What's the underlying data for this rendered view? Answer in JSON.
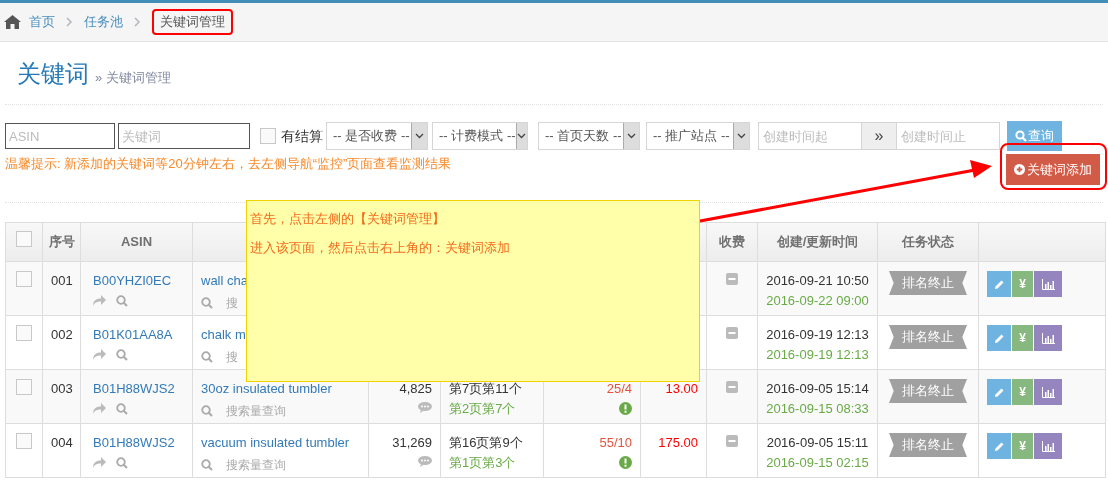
{
  "breadcrumb": [
    {
      "label": "首页",
      "current": false
    },
    {
      "label": "任务池",
      "current": false
    },
    {
      "label": "关键词管理",
      "current": true
    }
  ],
  "page_title": "关键词",
  "page_subtitle": "» 关键词管理",
  "filters": {
    "asin_placeholder": "ASIN",
    "keyword_placeholder": "关键词",
    "settled_label": "有结算",
    "settled_checked": false,
    "selects": [
      "-- 是否收费 --",
      "-- 计费模式 --",
      "-- 首页天数 --",
      "-- 推广站点 --"
    ],
    "date_from_placeholder": "创建时间起",
    "date_sep": "»",
    "date_to_placeholder": "创建时间止",
    "search_button": "查询"
  },
  "hint": "温馨提示: 新添加的关键词等20分钟左右，去左侧导航“监控”页面查看监测结果",
  "add_button": "关键词添加",
  "table": {
    "select_all_checked": false,
    "columns": [
      "序号",
      "ASIN",
      "收费",
      "创建/更新时间",
      "任务状态"
    ],
    "rows": [
      {
        "checked": false,
        "no": "001",
        "asin": "B00YHZI0EC",
        "keyword": "wall cha",
        "search_link": "搜",
        "created": "2016-09-21 10:50",
        "updated": "2016-09-22 09:00",
        "status": "排名终止",
        "actions": [
          {
            "kind": "edit"
          },
          {
            "kind": "price",
            "label": "¥"
          },
          {
            "kind": "chart"
          }
        ]
      },
      {
        "checked": false,
        "no": "002",
        "asin": "B01K01AA8A",
        "keyword": "chalk m",
        "search_link": "搜",
        "created": "2016-09-19 12:13",
        "updated": "2016-09-19 12:13",
        "status": "排名终止",
        "actions": [
          {
            "kind": "edit"
          },
          {
            "kind": "price",
            "label": "¥"
          },
          {
            "kind": "chart"
          }
        ]
      },
      {
        "checked": false,
        "no": "003",
        "asin": "B01H88WJS2",
        "keyword": "30oz insulated tumbler",
        "search_link": "搜索量查询",
        "volume": "4,825",
        "rank": "第7页第11个",
        "rank_home": "第2页第7个",
        "ratio": "25/4",
        "fee": "13.00",
        "created": "2016-09-05 15:14",
        "updated": "2016-09-15 08:33",
        "status": "排名终止",
        "actions": [
          {
            "kind": "edit"
          },
          {
            "kind": "price",
            "label": "¥"
          },
          {
            "kind": "chart"
          }
        ]
      },
      {
        "checked": false,
        "no": "004",
        "asin": "B01H88WJS2",
        "keyword": "vacuum insulated tumbler",
        "search_link": "搜索量查询",
        "volume": "31,269",
        "rank": "第16页第9个",
        "rank_home": "第1页第3个",
        "ratio": "55/10",
        "fee": "175.00",
        "created": "2016-09-05 15:11",
        "updated": "2016-09-15 02:15",
        "status": "排名终止",
        "actions": [
          {
            "kind": "edit"
          },
          {
            "kind": "price",
            "label": "¥"
          },
          {
            "kind": "chart"
          }
        ]
      }
    ]
  },
  "note": [
    "首先，点击左侧的【关键词管理】",
    "进入该页面，然后点击右上角的：关键词添加"
  ]
}
